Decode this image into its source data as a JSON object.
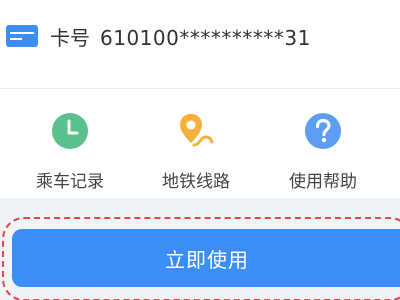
{
  "card": {
    "label": "卡号",
    "number": "610100**********31",
    "icon": "card-icon"
  },
  "actions": [
    {
      "label": "乘车记录",
      "icon": "clock-icon",
      "color": "#5ac18e"
    },
    {
      "label": "地铁线路",
      "icon": "location-route-icon",
      "color": "#f6b13d"
    },
    {
      "label": "使用帮助",
      "icon": "help-icon",
      "color": "#5b9ef4"
    }
  ],
  "primary_button": {
    "label": "立即使用",
    "color": "#3b8ef5"
  },
  "highlight_color": "#e0464a"
}
